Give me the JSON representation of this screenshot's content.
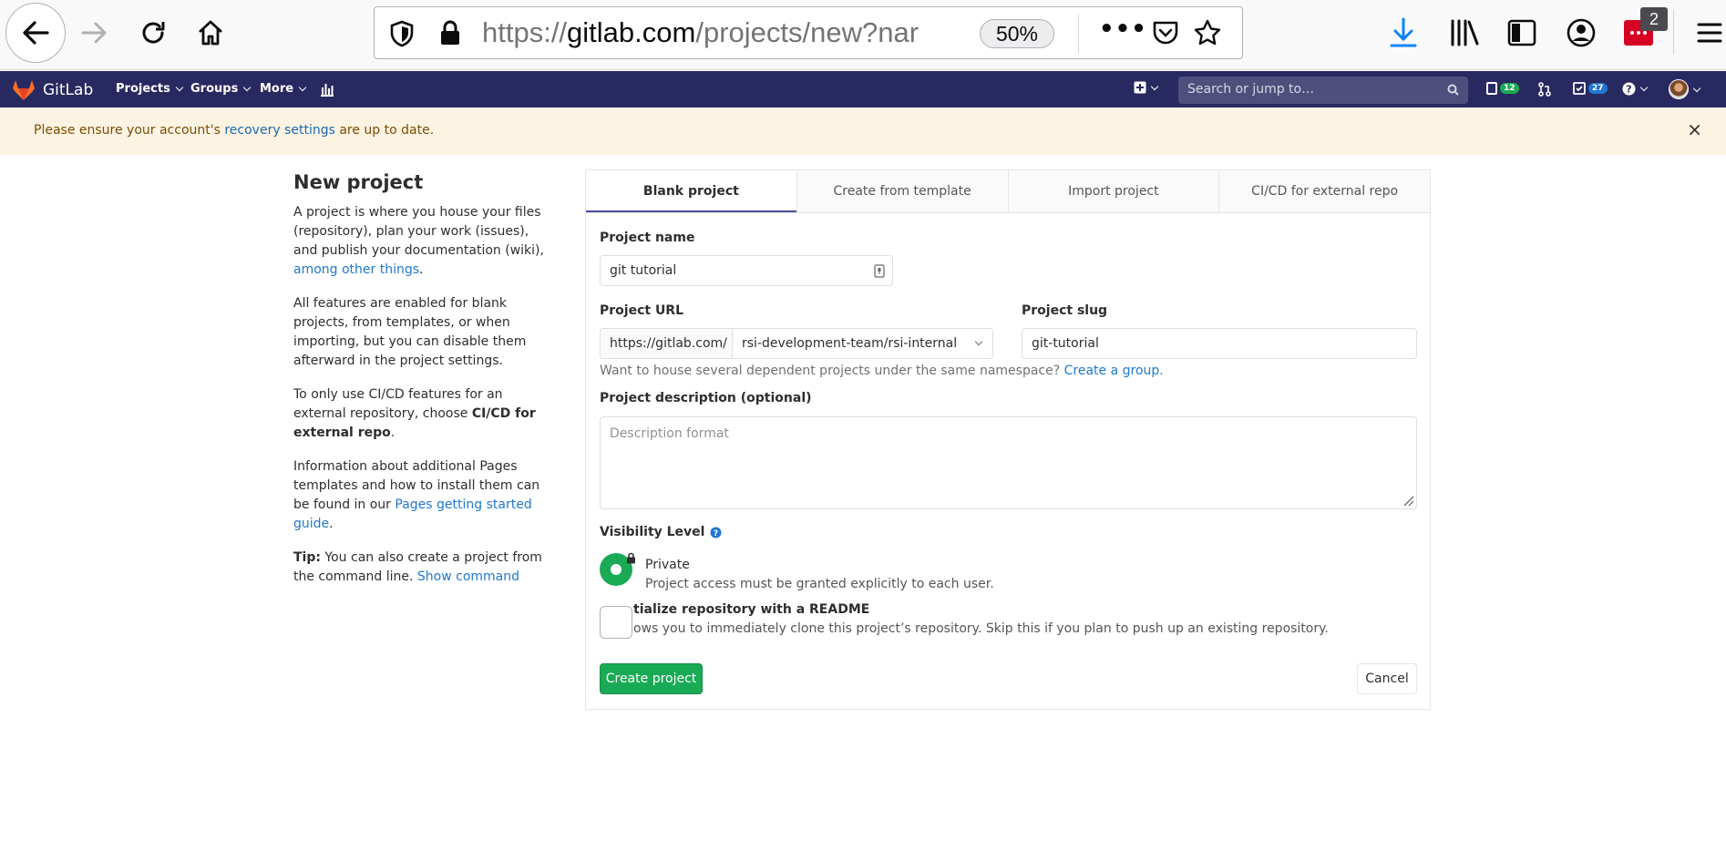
{
  "browser": {
    "url_scheme": "https://",
    "url_host": "gitlab.com",
    "url_path": "/projects/new?nar",
    "zoom": "50%",
    "more_dots": "•••",
    "notification_count": "2"
  },
  "navbar": {
    "brand": "GitLab",
    "projects": "Projects",
    "groups": "Groups",
    "more": "More",
    "search_placeholder": "Search or jump to…",
    "issues_count": "12",
    "todos_count": "27"
  },
  "alert": {
    "prefix": "Please ensure your account's ",
    "link": "recovery settings",
    "suffix": " are up to date.",
    "close": "×"
  },
  "info": {
    "title": "New project",
    "p1_text": "A project is where you house your files (repository), plan your work (issues), and publish your documentation (wiki), ",
    "p1_link": "among other things",
    "p1_end": ".",
    "p2": "All features are enabled for blank projects, from templates, or when importing, but you can disable them afterward in the project settings.",
    "p3_text": "To only use CI/CD features for an external repository, choose ",
    "p3_bold": "CI/CD for external repo",
    "p3_end": ".",
    "p4_text": "Information about additional Pages templates and how to install them can be found in our ",
    "p4_link": "Pages getting started guide",
    "p4_end": ".",
    "tip_bold": "Tip:",
    "tip_text": " You can also create a project from the command line. ",
    "tip_link": "Show command"
  },
  "tabs": [
    {
      "label": "Blank project",
      "active": true
    },
    {
      "label": "Create from template",
      "active": false
    },
    {
      "label": "Import project",
      "active": false
    },
    {
      "label": "CI/CD for external repo",
      "active": false
    }
  ],
  "form": {
    "project_name_label": "Project name",
    "project_name_value": "git tutorial",
    "project_url_label": "Project URL",
    "url_prefix": "https://gitlab.com/",
    "namespace_value": "rsi-development-team/rsi-internal",
    "project_slug_label": "Project slug",
    "project_slug_value": "git-tutorial",
    "namespace_help_text": "Want to house several dependent projects under the same namespace? ",
    "namespace_help_link": "Create a group.",
    "description_label": "Project description (optional)",
    "description_placeholder": "Description format",
    "visibility_label": "Visibility Level",
    "visibility_option_title": "Private",
    "visibility_option_desc": "Project access must be granted explicitly to each user.",
    "readme_title": "tialize repository with a README",
    "readme_desc": "ows you to immediately clone this project’s repository. Skip this if you plan to push up an existing repository.",
    "create_button": "Create project",
    "cancel_button": "Cancel"
  }
}
